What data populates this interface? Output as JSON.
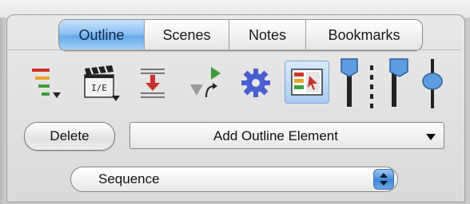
{
  "tabs": [
    {
      "label": "Outline",
      "selected": true
    },
    {
      "label": "Scenes",
      "selected": false
    },
    {
      "label": "Notes",
      "selected": false
    },
    {
      "label": "Bookmarks",
      "selected": false
    }
  ],
  "toolbar": {
    "icons": [
      "outline-levels-icon",
      "clapper-ie-icon",
      "collapse-icon",
      "arrows-icon",
      "gear-icon",
      "outline-select-icon",
      "text-size-small-icon",
      "text-size-large-icon",
      "zoom-slider-icon"
    ]
  },
  "actions": {
    "delete_label": "Delete",
    "add_element_label": "Add Outline Element"
  },
  "filter": {
    "selected_value": "Sequence"
  },
  "colors": {
    "tab_selected": "#8cc1f2",
    "stepper": "#3f86d6"
  }
}
